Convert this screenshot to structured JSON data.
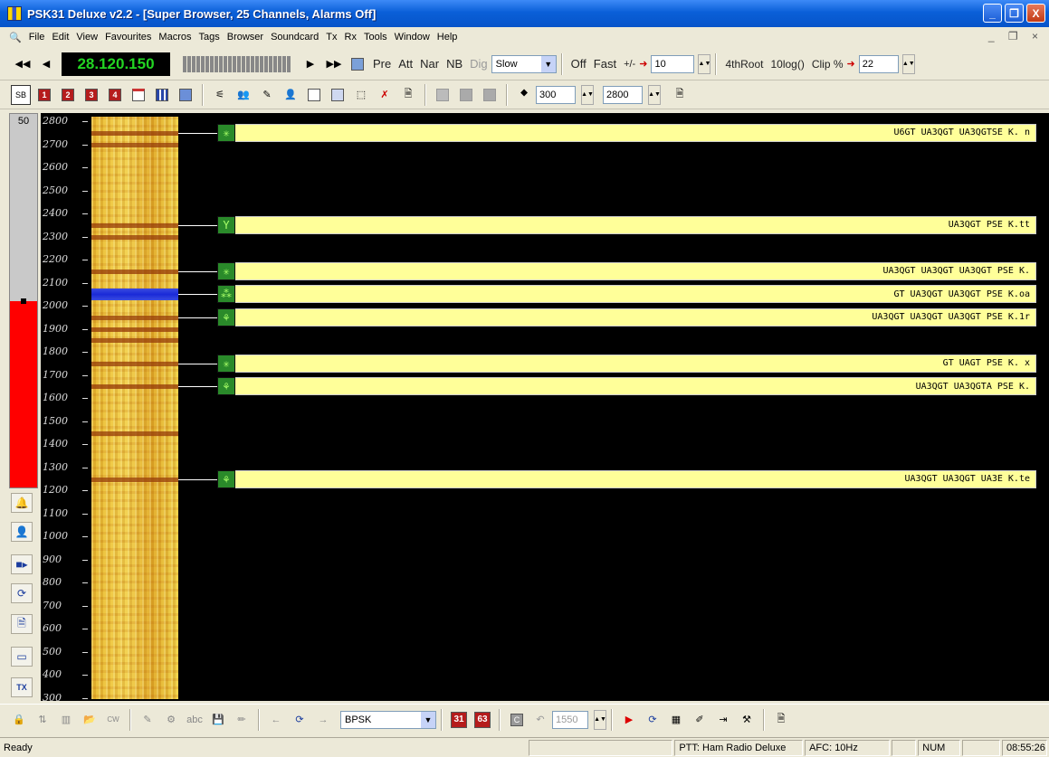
{
  "window": {
    "title": "PSK31 Deluxe v2.2 - [Super Browser, 25 Channels, Alarms Off]",
    "controls": [
      "_",
      "❐",
      "X"
    ]
  },
  "menu": {
    "items": [
      "File",
      "Edit",
      "View",
      "Favourites",
      "Macros",
      "Tags",
      "Browser",
      "Soundcard",
      "Tx",
      "Rx",
      "Tools",
      "Window",
      "Help"
    ],
    "mdi_controls": "_ ❐ ×"
  },
  "toolbar1": {
    "frequency": "28.120.150",
    "pre": "Pre",
    "att": "Att",
    "nar": "Nar",
    "nb": "NB",
    "dig": "Dig",
    "speed": "Slow",
    "off": "Off",
    "fast": "Fast",
    "plusminus": "+/-",
    "step": "10",
    "fourth_root": "4thRoot",
    "log": "10log()",
    "clip": "Clip %",
    "clip_value": "22"
  },
  "toolbar2": {
    "sb": "SB",
    "buttons": [
      "1",
      "2",
      "3",
      "4"
    ],
    "low_freq": "300",
    "high_freq": "2800"
  },
  "meter": {
    "value": "50",
    "level": 0.5
  },
  "axis": {
    "ticks": [
      "2800",
      "2700",
      "2600",
      "2500",
      "2400",
      "2300",
      "2200",
      "2100",
      "2000",
      "1900",
      "1800",
      "1700",
      "1600",
      "1500",
      "1400",
      "1300",
      "1200",
      "1100",
      "1000",
      "900",
      "800",
      "700",
      "600",
      "500",
      "400",
      "300"
    ]
  },
  "channels": [
    {
      "freq": 2750,
      "text": "U6GT UA3QGT UA3QGTSE K. n",
      "icon": "✳"
    },
    {
      "freq": 2350,
      "text": "UA3QGT PSE K.tt",
      "icon": "Y"
    },
    {
      "freq": 2150,
      "text": "UA3QGT UA3QGT UA3QGT PSE K.",
      "icon": "✳"
    },
    {
      "freq": 2050,
      "text": "GT UA3QGT UA3QGT PSE K.oa",
      "icon": "⁂"
    },
    {
      "freq": 1950,
      "text": "UA3QGT UA3QGT UA3QGT PSE K.1r",
      "icon": "⚘"
    },
    {
      "freq": 1750,
      "text": "GT UAGT PSE K. x",
      "icon": "✳"
    },
    {
      "freq": 1650,
      "text": "UA3QGT UA3QGTA PSE K.",
      "icon": "⚘"
    },
    {
      "freq": 1250,
      "text": "UA3QGT UA3QGT UA3E K.te",
      "icon": "⚘"
    }
  ],
  "bottom": {
    "mode": "BPSK",
    "b31": "31",
    "b63": "63",
    "c": "C",
    "freq": "1550"
  },
  "status": {
    "ready": "Ready",
    "ptt": "PTT: Ham Radio Deluxe",
    "afc": "AFC: 10Hz",
    "num": "NUM",
    "time": "08:55:26"
  }
}
